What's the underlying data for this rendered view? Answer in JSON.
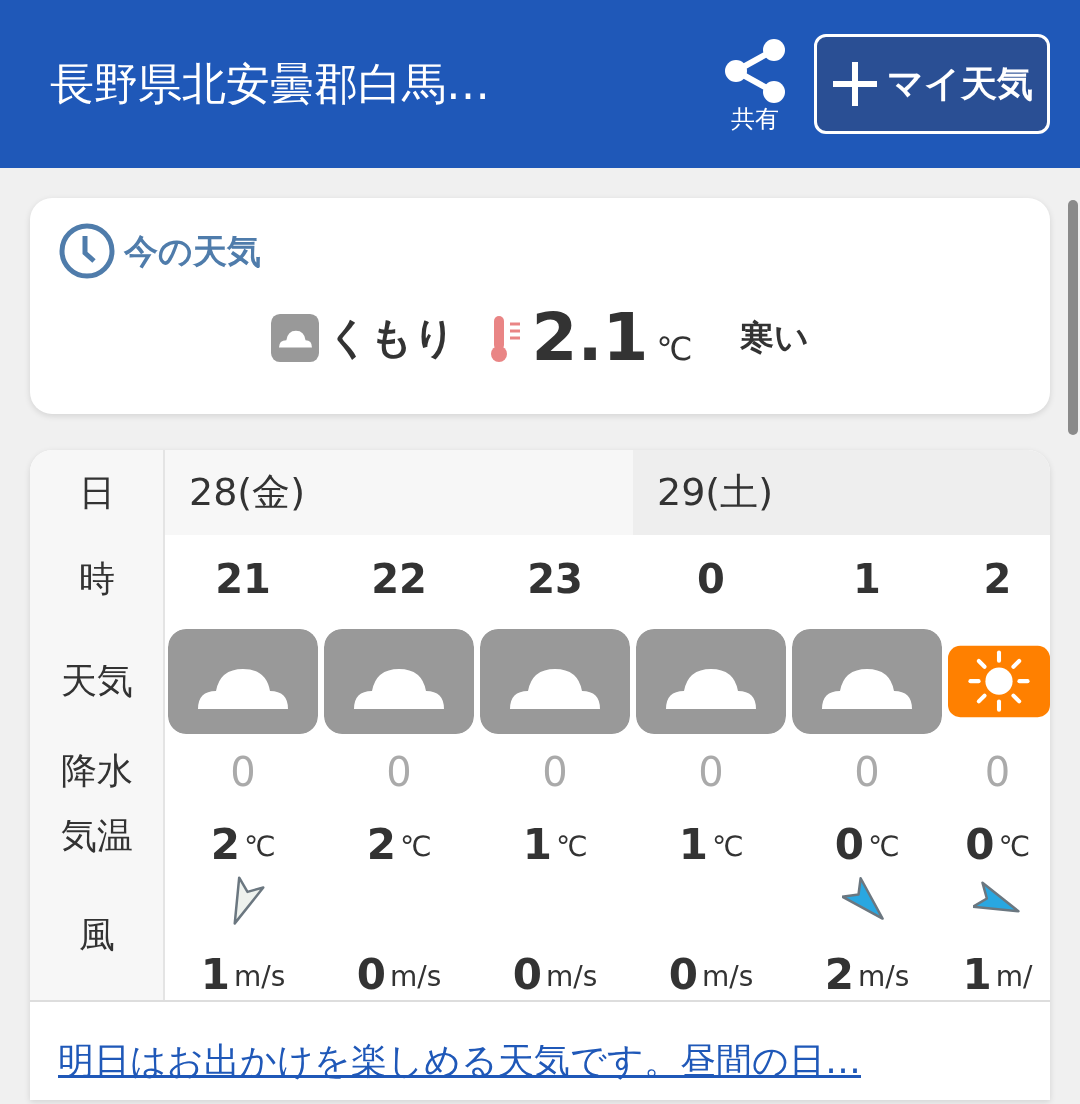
{
  "header": {
    "title": "長野県北安曇郡白馬…",
    "share_label": "共有",
    "my_weather_button": "マイ天気"
  },
  "current": {
    "title": "今の天気",
    "weather": "くもり",
    "kind": "cloudy",
    "temperature": "2.1",
    "unit": "℃",
    "feeling": "寒い"
  },
  "forecast": {
    "row_labels": {
      "day": "日",
      "hour": "時",
      "weather": "天気",
      "precip": "降水",
      "temp": "気温",
      "wind": "風"
    },
    "days": [
      {
        "label": "28(金)",
        "hours": [
          {
            "hour": "21",
            "kind": "cloudy",
            "precip": "0",
            "temp": "2",
            "temp_unit": "℃",
            "wind_arrow": {
              "kind": "ssw",
              "color": "#eef2ee"
            },
            "wind": "1",
            "wind_unit": "m/s"
          },
          {
            "hour": "22",
            "kind": "cloudy",
            "precip": "0",
            "temp": "2",
            "temp_unit": "℃",
            "wind": "0",
            "wind_unit": "m/s"
          },
          {
            "hour": "23",
            "kind": "cloudy",
            "precip": "0",
            "temp": "1",
            "temp_unit": "℃",
            "wind": "0",
            "wind_unit": "m/s"
          }
        ]
      },
      {
        "label": "29(土)",
        "hours": [
          {
            "hour": "0",
            "kind": "cloudy",
            "precip": "0",
            "temp": "1",
            "temp_unit": "℃",
            "wind": "0",
            "wind_unit": "m/s"
          },
          {
            "hour": "1",
            "kind": "cloudy",
            "precip": "0",
            "temp": "0",
            "temp_unit": "℃",
            "wind_arrow": {
              "kind": "se",
              "color": "#29a7e1"
            },
            "wind": "2",
            "wind_unit": "m/s"
          },
          {
            "hour": "2",
            "kind": "sunny",
            "precip": "0",
            "temp": "0",
            "temp_unit": "℃",
            "wind_arrow": {
              "kind": "ese",
              "color": "#29a7e1"
            },
            "wind": "1",
            "wind_unit": "m/"
          }
        ]
      }
    ]
  },
  "comment_link": "明日はお出かけを楽しめる天気です。昼間の日…"
}
